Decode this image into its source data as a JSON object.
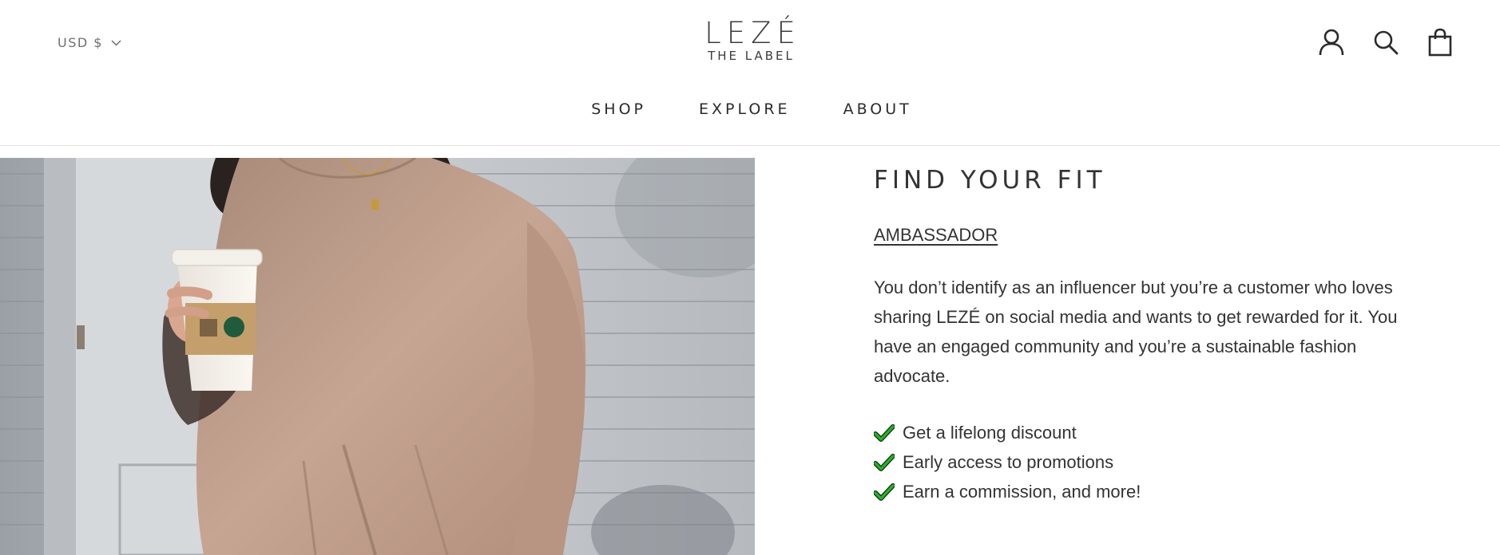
{
  "header": {
    "currency": "USD $",
    "logo_main": "LEZÉ",
    "logo_sub": "THE LABEL",
    "icons": [
      "account-icon",
      "search-icon",
      "cart-icon"
    ]
  },
  "nav": {
    "items": [
      "SHOP",
      "EXPLORE",
      "ABOUT"
    ]
  },
  "hero": {
    "image_subject": "woman in tan oversized sweatshirt holding coffee cup"
  },
  "main": {
    "title": "FIND YOUR FIT",
    "link_label": "AMBASSADOR ",
    "description": "You don’t identify as an influencer but you’re a customer who loves sharing LEZÉ on social media and wants to get rewarded for it. You have an engaged community and you’re a sustainable fashion advocate.",
    "benefits": [
      "Get a lifelong discount",
      "Early access to promotions",
      "Earn a commission, and more!"
    ]
  },
  "colors": {
    "text": "#333333",
    "check": "#1c8a1c",
    "divider": "#e3e3e3"
  }
}
